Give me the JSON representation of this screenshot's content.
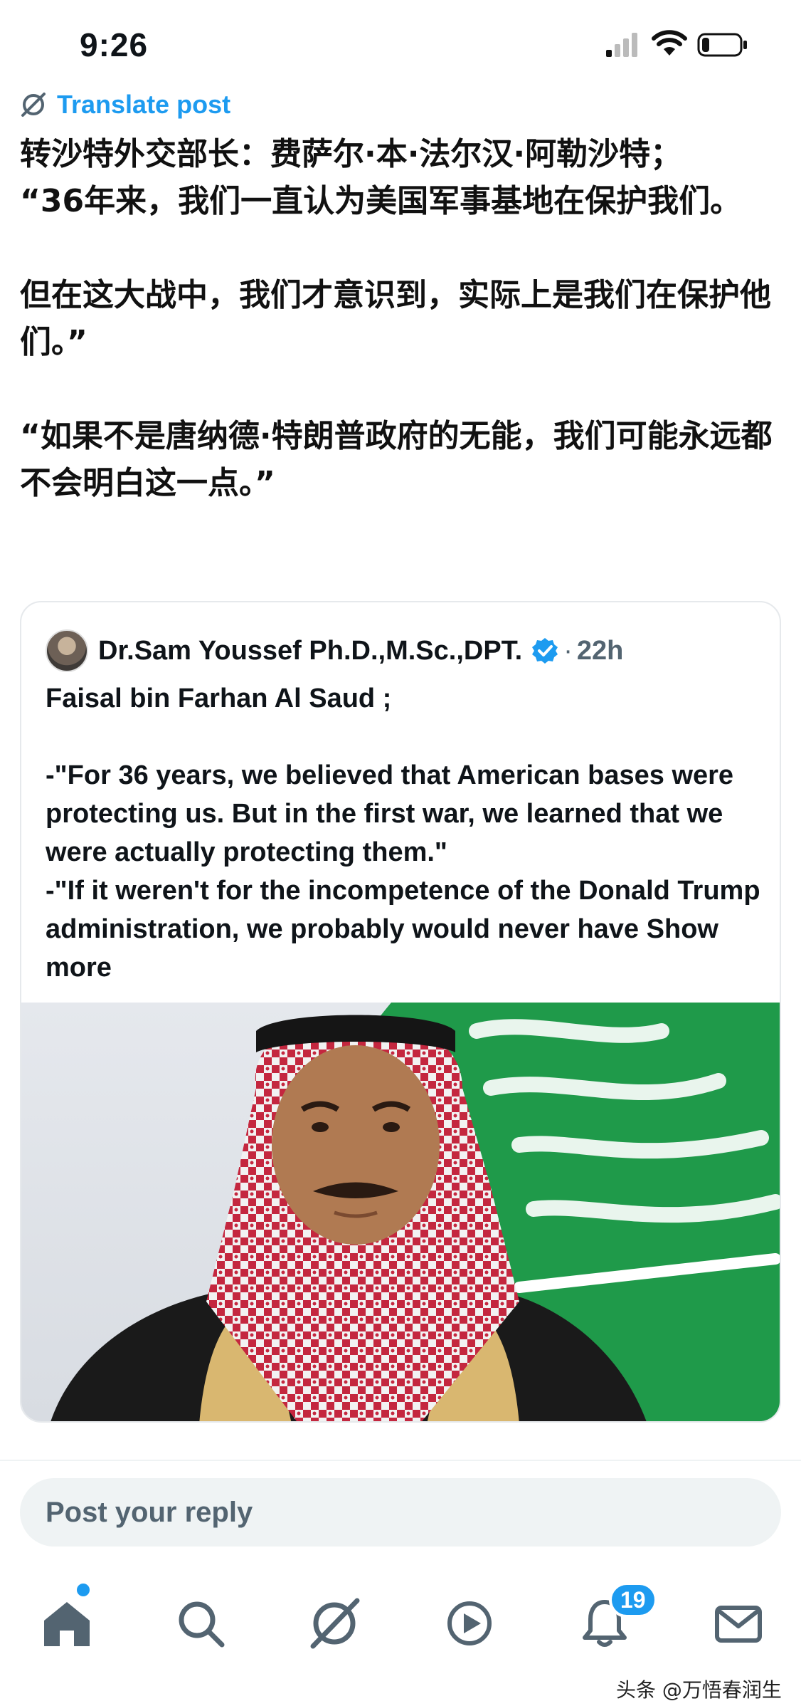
{
  "status_bar": {
    "time": "9:26"
  },
  "translate": {
    "label": "Translate post"
  },
  "post": {
    "line1": "转沙特外交部长：费萨尔·本·法尔汉·阿勒沙特；",
    "line2": "“36年来，我们一直认为美国军事基地在保护我们。",
    "line3": "但在这大战中，我们才意识到，实际上是我们在保护他们。”",
    "line4": "“如果不是唐纳德·特朗普政府的无能，我们可能永远都不会明白这一点。”"
  },
  "quoted": {
    "author": "Dr.Sam Youssef Ph.D.,M.Sc.,DPT.",
    "separator": "·",
    "time": "22h",
    "title": "Faisal bin Farhan Al Saud ;",
    "quote1": "-\"For 36 years, we believed that American bases were protecting us. But in the first war, we learned that we were actually protecting them.\"",
    "quote2": "-\"If it weren't for the incompetence of the Donald Trump administration, we probably would never have",
    "show_more": "Show more"
  },
  "reply": {
    "placeholder": "Post your reply"
  },
  "nav": {
    "items": [
      "home-icon",
      "search-icon",
      "grok-icon",
      "video-icon",
      "notifications-icon",
      "messages-icon"
    ],
    "notification_count": "19"
  },
  "watermark": "头条 @万悟春润生",
  "colors": {
    "accent": "#1d9bf0",
    "text": "#0f1419",
    "muted": "#536471",
    "flag_green": "#1f9a4a"
  }
}
